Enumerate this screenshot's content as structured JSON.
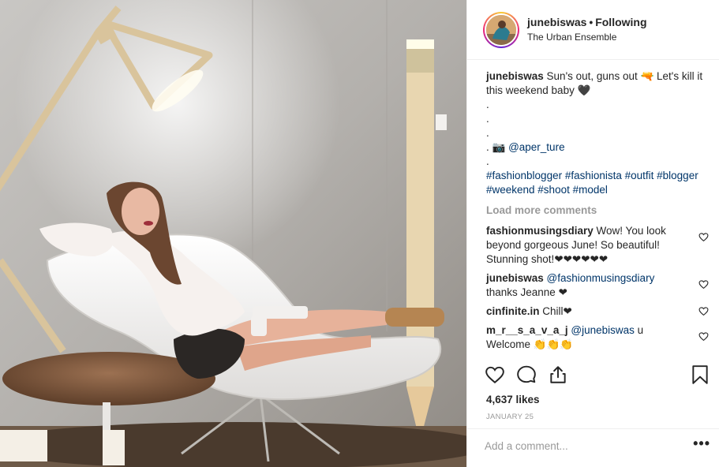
{
  "header": {
    "username": "junebiswas",
    "separator": "•",
    "follow_status": "Following",
    "location": "The Urban Ensemble"
  },
  "caption": {
    "username": "junebiswas",
    "line1": "Sun's out, guns out 🔫 Let's kill it this weekend baby 🖤",
    "dots": [
      ".",
      ".",
      "."
    ],
    "credit_prefix": ". 📷",
    "credit_mention": "@aper_ture",
    "dot_last": ".",
    "hashtags": "#fashionblogger #fashionista #outfit #blogger #weekend #shoot #model"
  },
  "load_more": "Load more comments",
  "comments": [
    {
      "user": "fashionmusingsdiary",
      "text": "Wow! You look beyond gorgeous June! So beautiful! Stunning shot!❤❤❤❤❤❤",
      "mention": ""
    },
    {
      "user": "junebiswas",
      "mention": "@fashionmusingsdiary",
      "text": " thanks Jeanne ❤"
    },
    {
      "user": "cinfinite.in",
      "mention": "",
      "text": "Chill❤"
    },
    {
      "user": "m_r__s_a_v_a_j",
      "mention": "@junebiswas",
      "text": " u Welcome 👏👏👏"
    }
  ],
  "likes": "4,637 likes",
  "date": "JANUARY 25",
  "add_comment_placeholder": "Add a comment...",
  "more_label": "•••",
  "icons": {
    "like": "heart-icon",
    "comment": "comment-icon",
    "share": "share-icon",
    "save": "bookmark-icon",
    "more": "more-options-icon"
  },
  "colors": {
    "link": "#003569",
    "muted": "#999999",
    "text": "#262626",
    "border": "#efefef"
  }
}
